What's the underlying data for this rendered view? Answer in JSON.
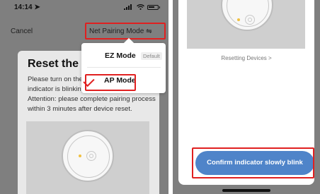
{
  "status_bar": {
    "time": "14:14 ➤"
  },
  "nav": {
    "cancel": "Cancel",
    "mode": "Net Pairing Mode",
    "mode_icon": "⇋"
  },
  "card": {
    "title": "Reset the de",
    "lines": [
      "Please turn on the d",
      "indicator is blinking",
      "Attention: please complete pairing process",
      "within 3 minutes after device reset."
    ]
  },
  "dropdown": {
    "options": [
      {
        "label": "EZ Mode",
        "badge": "Default"
      },
      {
        "label": "AP Mode",
        "badge": ""
      }
    ],
    "selected_index": 1
  },
  "right": {
    "link": "Resetting Devices >",
    "confirm": "Confirm indicator slowly blink"
  },
  "colors": {
    "accent": "#4f84c9",
    "highlight": "#e02020",
    "led": "#f0c040"
  },
  "icons": [
    "signal-icon",
    "wifi-icon",
    "battery-icon",
    "swap-icon",
    "checkmark-icon"
  ]
}
